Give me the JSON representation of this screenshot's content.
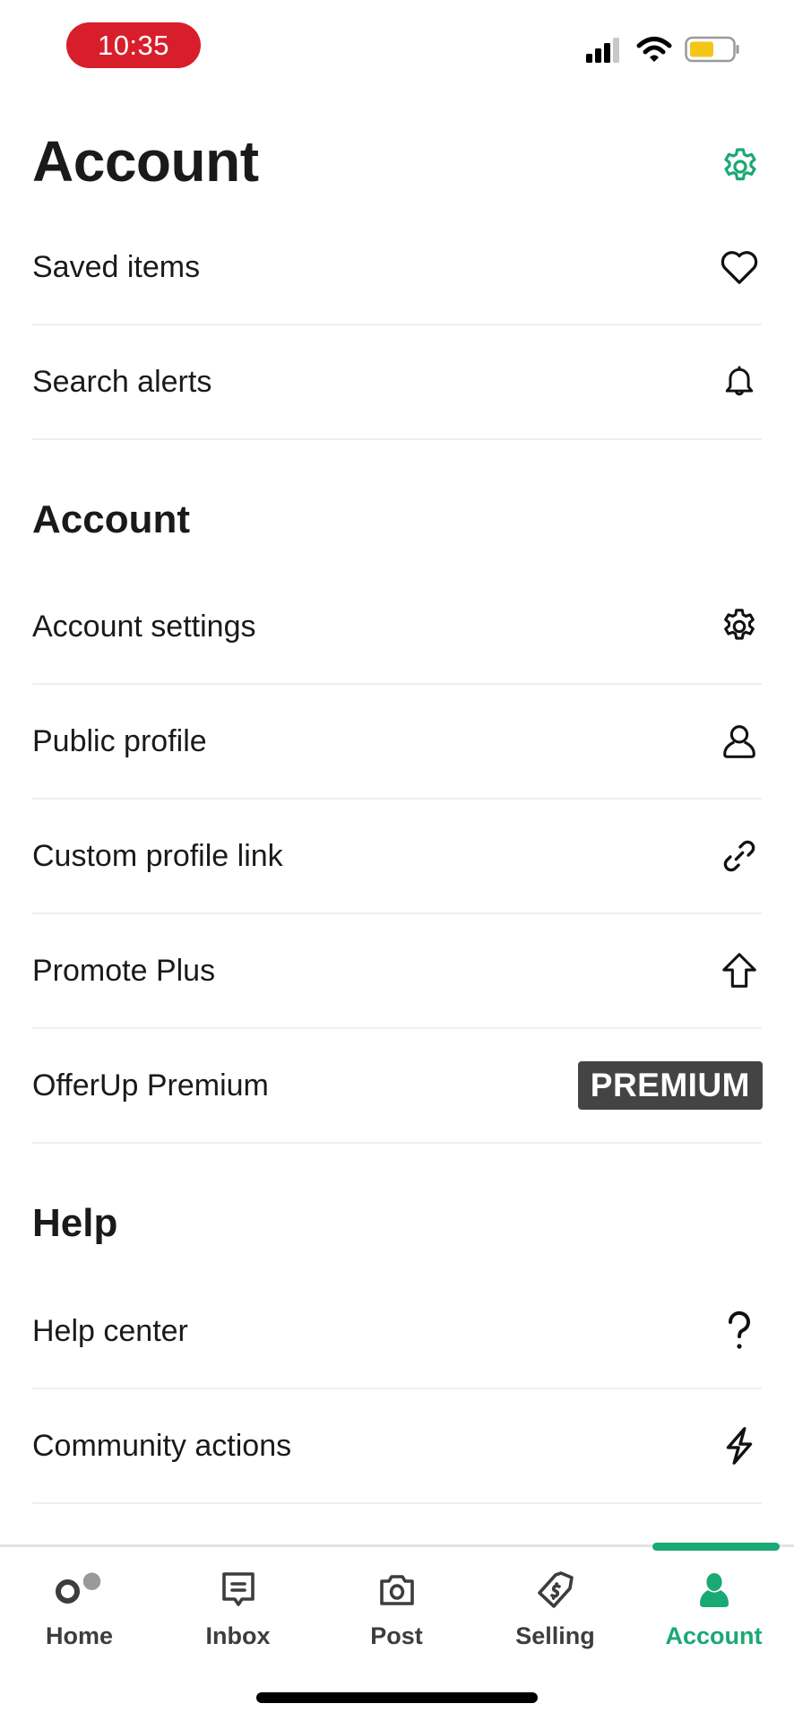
{
  "status_bar": {
    "time": "10:35",
    "icons": [
      "signal-icon",
      "wifi-icon",
      "battery-icon"
    ],
    "battery_color": "#f5c518",
    "time_pill_color": "#d81e2a"
  },
  "header": {
    "title": "Account",
    "settings_icon": "gear-icon",
    "accent_color": "#1aa874"
  },
  "quick_items": [
    {
      "label": "Saved items",
      "icon": "heart-icon"
    },
    {
      "label": "Search alerts",
      "icon": "bell-icon"
    }
  ],
  "sections": {
    "account": {
      "title": "Account",
      "items": [
        {
          "label": "Account settings",
          "icon": "gear-icon"
        },
        {
          "label": "Public profile",
          "icon": "person-icon"
        },
        {
          "label": "Custom profile link",
          "icon": "link-icon"
        },
        {
          "label": "Promote Plus",
          "icon": "arrow-up-icon"
        },
        {
          "label": "OfferUp Premium",
          "badge": "PREMIUM"
        }
      ]
    },
    "help": {
      "title": "Help",
      "items": [
        {
          "label": "Help center",
          "icon": "question-icon"
        },
        {
          "label": "Community actions",
          "icon": "lightning-icon"
        }
      ]
    }
  },
  "tab_bar": {
    "tabs": [
      {
        "label": "Home",
        "icon": "home-logo-icon"
      },
      {
        "label": "Inbox",
        "icon": "message-icon"
      },
      {
        "label": "Post",
        "icon": "camera-icon"
      },
      {
        "label": "Selling",
        "icon": "price-tag-icon"
      },
      {
        "label": "Account",
        "icon": "person-filled-icon",
        "active": true
      }
    ]
  }
}
